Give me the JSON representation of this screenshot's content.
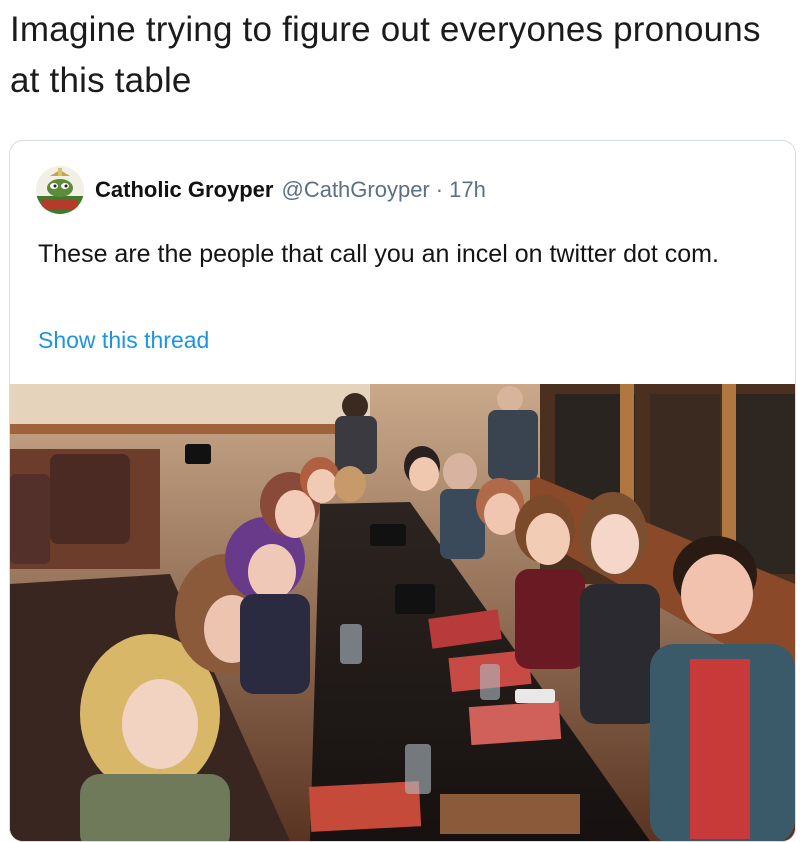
{
  "caption": "Imagine trying to figure out everyones pronouns at this table",
  "tweet": {
    "display_name": "Catholic Groyper",
    "handle": "@CathGroyper",
    "separator": "·",
    "time": "17h",
    "text": "These are the people that call you an incel on twitter dot com.",
    "show_thread": "Show this thread",
    "avatar_icon": "groyper-avatar-icon",
    "photo_icon": "restaurant-group-photo",
    "colors": {
      "link": "#1b95e0",
      "secondary_text": "#5b7083",
      "card_border": "#d7dde2"
    }
  }
}
